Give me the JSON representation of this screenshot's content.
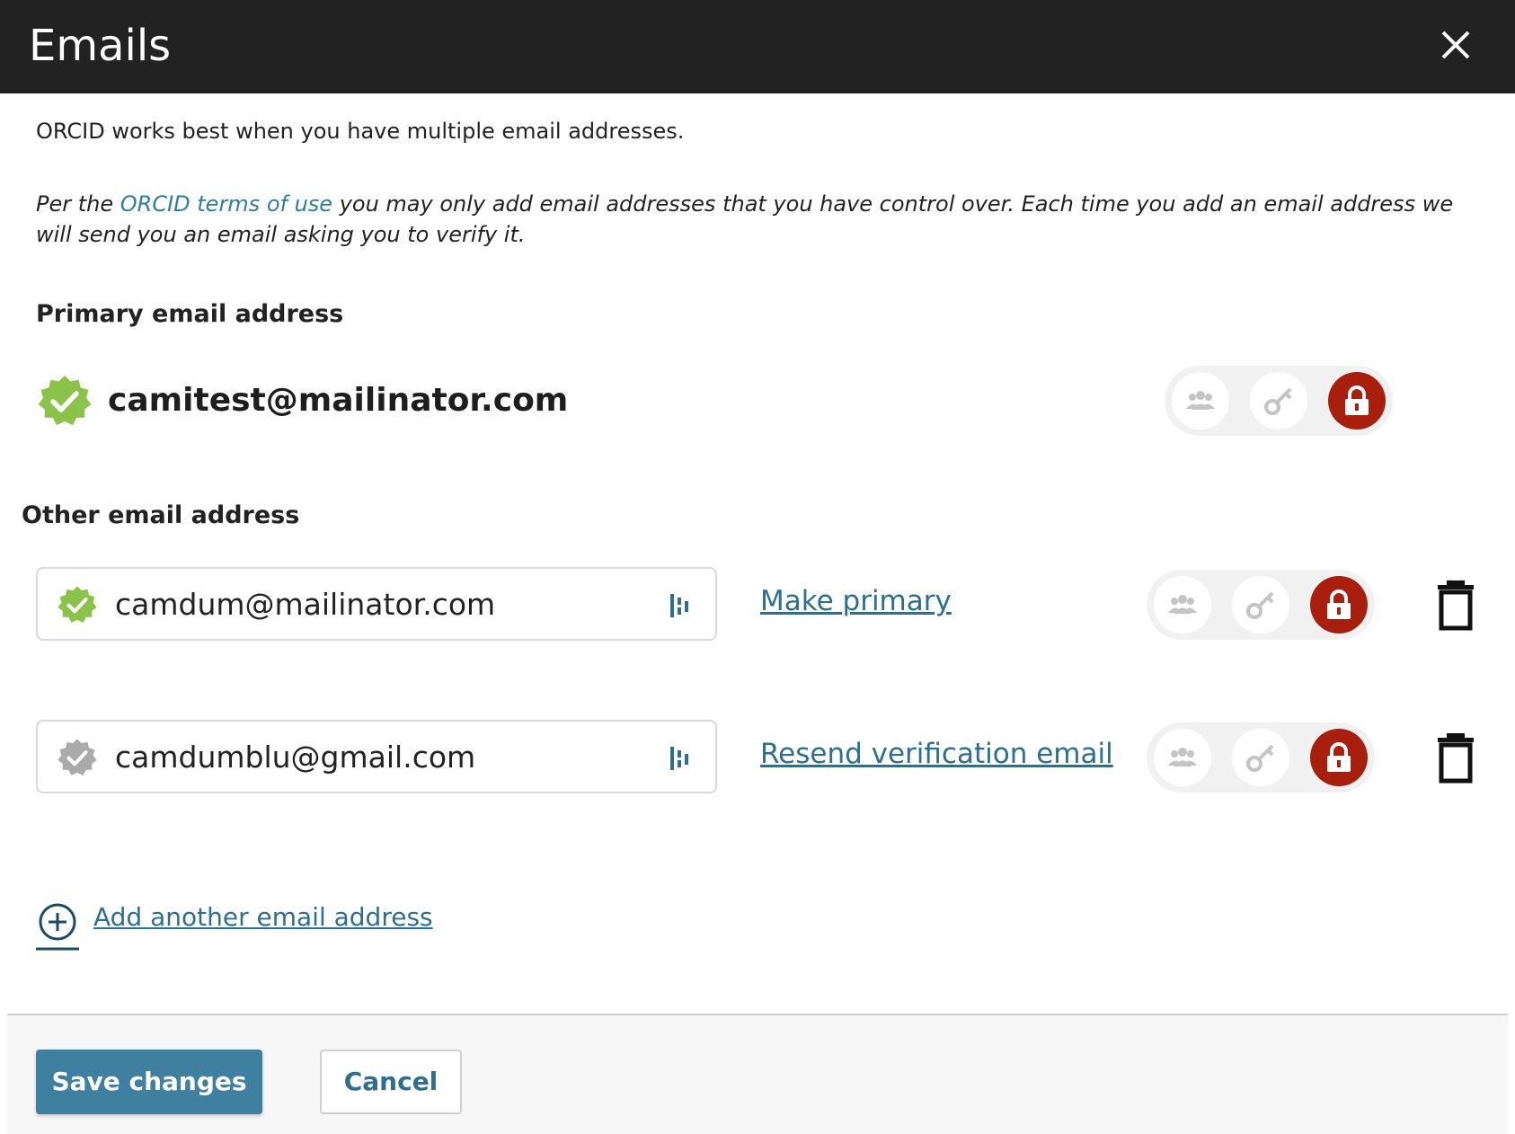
{
  "dialog": {
    "title": "Emails",
    "close_icon": "close-icon"
  },
  "intro": "ORCID works best when you have multiple email addresses.",
  "terms": {
    "prefix": "Per the ",
    "link": "ORCID terms of use",
    "suffix": " you may only add email addresses that you have control over. Each time you add an email address we will send you an email asking you to verify it."
  },
  "primary": {
    "heading": "Primary email address",
    "email": "camitest@mailinator.com",
    "verified": true,
    "visibility": "private"
  },
  "other": {
    "heading": "Other email address",
    "emails": [
      {
        "email": "camdum@mailinator.com",
        "verified": true,
        "action": "Make primary",
        "visibility": "private"
      },
      {
        "email": "camdumblu@gmail.com",
        "verified": false,
        "action": "Resend verification email",
        "visibility": "private"
      }
    ]
  },
  "add_link": "Add another email address",
  "footer": {
    "save": "Save changes",
    "cancel": "Cancel"
  },
  "colors": {
    "header_bg": "#222222",
    "link": "#2e6f8e",
    "verified_green": "#8bc34a",
    "unverified_gray": "#aaaaaa",
    "private_red": "#a8200d",
    "save_button": "#3f7f9f"
  },
  "icons": {
    "visibility_everyone": "people-icon",
    "visibility_trusted": "key-icon",
    "visibility_private": "lock-icon",
    "delete": "trash-icon",
    "drag": "drag-handle-icon",
    "add": "add-circle-icon",
    "verified": "verified-badge-icon"
  }
}
